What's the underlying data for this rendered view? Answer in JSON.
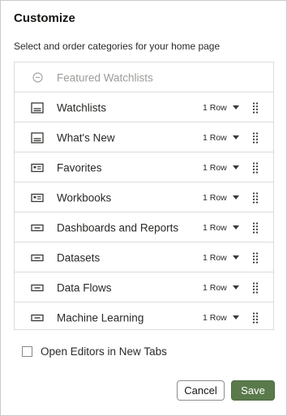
{
  "dialog": {
    "title": "Customize",
    "subtitle": "Select and order categories for your home page"
  },
  "colors": {
    "save_button": "#5a7a4c",
    "border": "#dcdbd9",
    "disabled_text": "#9e9c99"
  },
  "categories": [
    {
      "label": "Featured Watchlists",
      "icon": "minus-circle-icon",
      "enabled": false,
      "rows": ""
    },
    {
      "label": "Watchlists",
      "icon": "watchlist-icon",
      "enabled": true,
      "rows": "1 Row"
    },
    {
      "label": "What's New",
      "icon": "watchlist-icon",
      "enabled": true,
      "rows": "1 Row"
    },
    {
      "label": "Favorites",
      "icon": "card-icon",
      "enabled": true,
      "rows": "1 Row"
    },
    {
      "label": "Workbooks",
      "icon": "card-icon",
      "enabled": true,
      "rows": "1 Row"
    },
    {
      "label": "Dashboards and Reports",
      "icon": "bar-icon",
      "enabled": true,
      "rows": "1 Row"
    },
    {
      "label": "Datasets",
      "icon": "bar-icon",
      "enabled": true,
      "rows": "1 Row"
    },
    {
      "label": "Data Flows",
      "icon": "bar-icon",
      "enabled": true,
      "rows": "1 Row"
    },
    {
      "label": "Machine Learning",
      "icon": "bar-icon",
      "enabled": true,
      "rows": "1 Row"
    }
  ],
  "options": {
    "open_editors_label": "Open Editors in New Tabs",
    "open_editors_checked": false
  },
  "buttons": {
    "cancel": "Cancel",
    "save": "Save"
  }
}
